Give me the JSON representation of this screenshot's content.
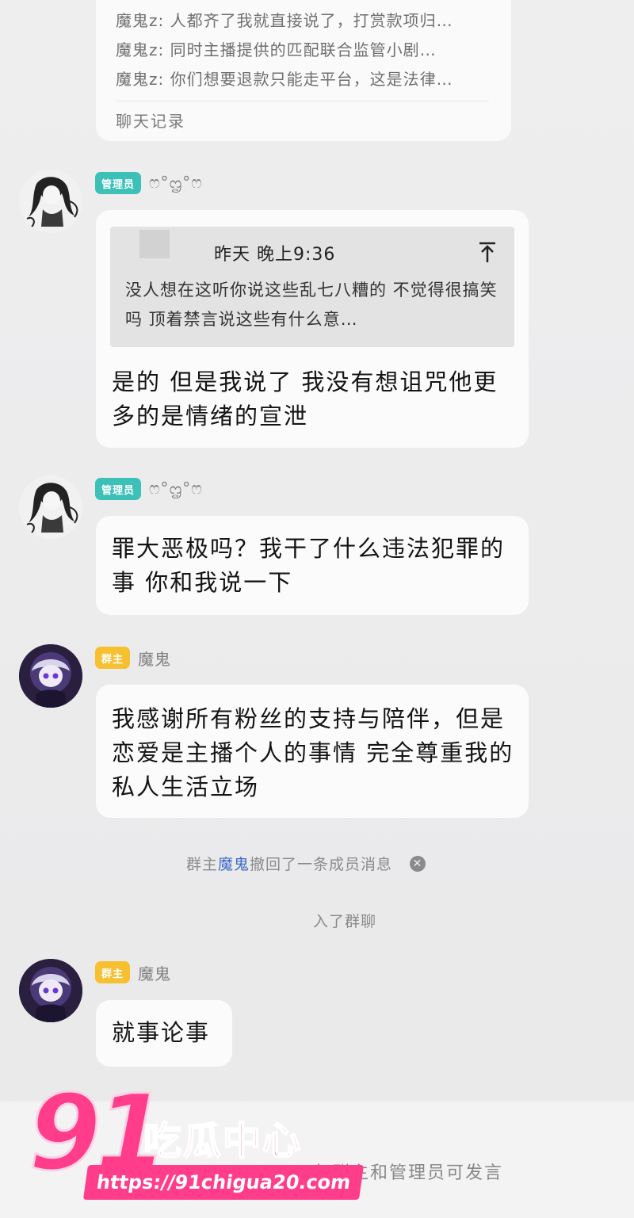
{
  "chat_record": {
    "lines": [
      "魔鬼z: 人都齐了我就直接说了，打赏款项归…",
      "魔鬼z: 同时主播提供的匹配联合监管小剧…",
      "魔鬼z: 你们想要退款只能走平台，这是法律…"
    ],
    "footer": "聊天记录"
  },
  "messages": [
    {
      "badge": "管理员",
      "name": "ෆ°ᦗ°ෆ",
      "quote": {
        "time": "昨天 晚上9:36",
        "text": "没人想在这听你说这些乱七八糟的 不觉得很搞笑吗 顶着禁言说这些有什么意…"
      },
      "text": "是的 但是我说了 我没有想诅咒他更多的是情绪的宣泄"
    },
    {
      "badge": "管理员",
      "name": "ෆ°ᦗ°ෆ",
      "text": "罪大恶极吗？我干了什么违法犯罪的事 你和我说一下"
    },
    {
      "badge": "群主",
      "name": "魔鬼",
      "text": "我感谢所有粉丝的支持与陪伴，但是恋爱是主播个人的事情  完全尊重我的私人生活立场"
    },
    {
      "badge": "群主",
      "name": "魔鬼",
      "text": "就事论事"
    }
  ],
  "system": {
    "recall_prefix": "群主",
    "recall_name": "魔鬼",
    "recall_suffix": "撤回了一条成员消息",
    "joined": "入了群聊"
  },
  "bottom": {
    "text": "仅群主和管理员可发言"
  },
  "watermark": {
    "number": "91",
    "name": "吃瓜中心",
    "url": "https://91chigua20.com"
  },
  "colors": {
    "admin_badge": "#3cc0b8",
    "owner_badge": "#f6c031",
    "recall_name": "#3a69c9",
    "watermark": "#ff3d8b"
  }
}
